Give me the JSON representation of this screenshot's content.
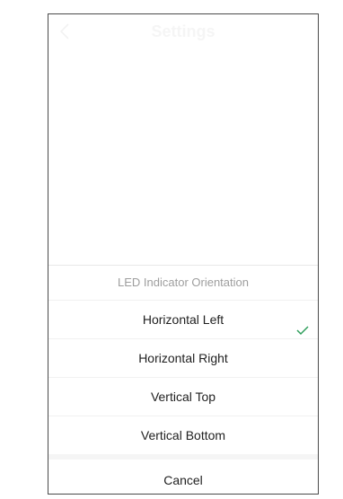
{
  "header": {
    "title": "Settings",
    "back_icon": "chevron-left-icon"
  },
  "sheet": {
    "title": "LED Indicator Orientation",
    "options": [
      {
        "label": "Horizontal Left",
        "selected": true
      },
      {
        "label": "Horizontal Right",
        "selected": false
      },
      {
        "label": "Vertical Top",
        "selected": false
      },
      {
        "label": "Vertical Bottom",
        "selected": false
      }
    ],
    "cancel_label": "Cancel",
    "check_icon": "checkmark-icon",
    "accent_color": "#2e9e5b"
  }
}
